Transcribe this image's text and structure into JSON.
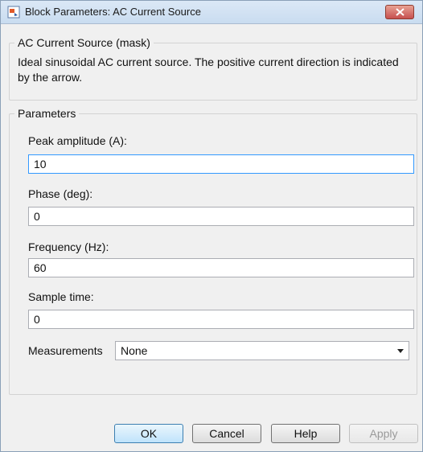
{
  "window": {
    "title": "Block Parameters: AC Current Source",
    "close_icon": "close-icon"
  },
  "mask": {
    "group_title": "AC Current Source (mask)",
    "description": "Ideal sinusoidal AC current source. The positive current direction is indicated by the arrow."
  },
  "parameters": {
    "group_title": "Parameters",
    "fields": [
      {
        "label": "Peak amplitude (A):",
        "value": "10"
      },
      {
        "label": "Phase (deg):",
        "value": "0"
      },
      {
        "label": "Frequency (Hz):",
        "value": "60"
      },
      {
        "label": "Sample time:",
        "value": "0"
      }
    ],
    "measurements": {
      "label": "Measurements",
      "value": "None"
    }
  },
  "buttons": {
    "ok": "OK",
    "cancel": "Cancel",
    "help": "Help",
    "apply": "Apply"
  },
  "colors": {
    "title_bar": "#c9dcf0",
    "close_button": "#c75050",
    "focus_border": "#3399ff"
  }
}
